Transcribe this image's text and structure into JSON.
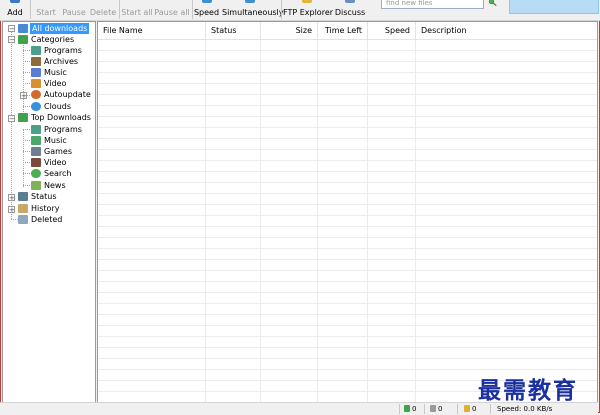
{
  "toolbar": {
    "add": "Add",
    "start": "Start",
    "pause": "Pause",
    "delete": "Delete",
    "start_all": "Start all",
    "pause_all": "Pause all",
    "speed": "Speed",
    "simultaneously": "Simultaneously",
    "ftp_explorer": "FTP Explorer",
    "discuss": "Discuss",
    "search_placeholder": "find new files"
  },
  "tree": {
    "all_downloads": "All downloads",
    "categories": "Categories",
    "cat_programs": "Programs",
    "cat_archives": "Archives",
    "cat_music": "Music",
    "cat_video": "Video",
    "cat_autoupdate": "Autoupdate",
    "cat_clouds": "Clouds",
    "top_downloads": "Top Downloads",
    "top_programs": "Programs",
    "top_music": "Music",
    "top_games": "Games",
    "top_video": "Video",
    "top_search": "Search",
    "top_news": "News",
    "status": "Status",
    "history": "History",
    "deleted": "Deleted"
  },
  "list": {
    "columns": {
      "file_name": "File Name",
      "status": "Status",
      "size": "Size",
      "time_left": "Time Left",
      "speed": "Speed",
      "description": "Description"
    }
  },
  "statusbar": {
    "active": "0",
    "queued": "0",
    "completed": "0",
    "speed": "Speed: 0.0 KB/s"
  },
  "watermark": "最需教育",
  "colors": {
    "selection": "#3399ff",
    "window_border": "#c23b3b",
    "banner": "#b7dcf6",
    "watermark": "#1a2fa0"
  }
}
